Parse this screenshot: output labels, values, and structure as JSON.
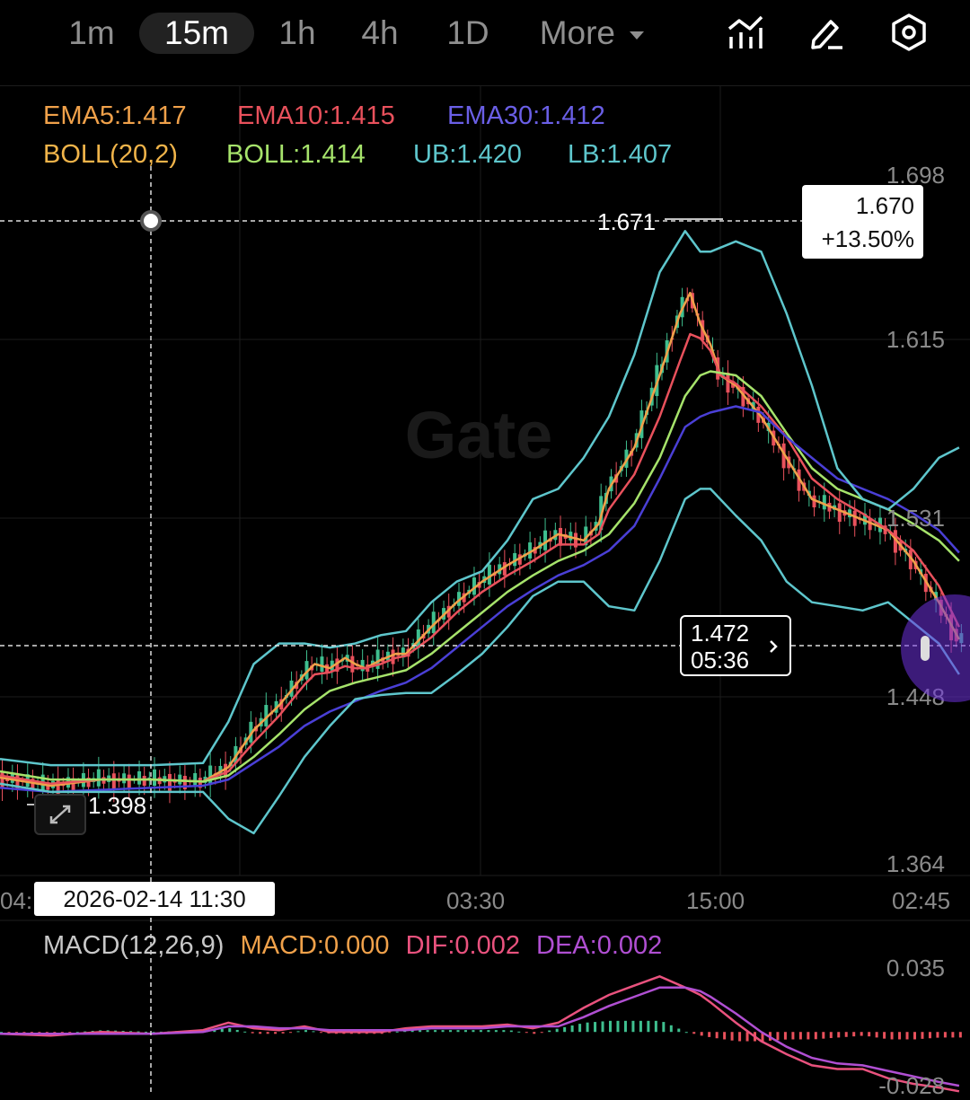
{
  "toolbar": {
    "timeframes": [
      "1m",
      "15m",
      "1h",
      "4h",
      "1D"
    ],
    "active_timeframe": "15m",
    "more_label": "More",
    "icons": [
      "indicator-icon",
      "draw-pen-icon",
      "settings-icon"
    ]
  },
  "legend": {
    "ema5": "EMA5:1.417",
    "ema10": "EMA10:1.415",
    "ema30": "EMA30:1.412",
    "boll_params": "BOLL(20,2)",
    "boll": "BOLL:1.414",
    "ub": "UB:1.420",
    "lb": "LB:1.407"
  },
  "price_box": {
    "price": "1.670",
    "change": "+13.50%"
  },
  "high_label": "1.671",
  "low_label": "1.398",
  "current": {
    "price": "1.472",
    "countdown": "05:36"
  },
  "crosshair_time": "2026-02-14 11:30",
  "watermark": "Gate",
  "macd_legend": {
    "params": "MACD(12,26,9)",
    "macd": "MACD:0.000",
    "dif": "DIF:0.002",
    "dea": "DEA:0.002"
  },
  "colors": {
    "up": "#3fbf8f",
    "down": "#e9515c",
    "ema5": "#f0a14a",
    "ema10": "#e9515c",
    "ema30": "#4a3fd6",
    "boll": "#a6e36b",
    "bands": "#5ec6cc",
    "dif": "#e9527e",
    "dea": "#b04fd2"
  },
  "chart_data": [
    {
      "type": "candlestick",
      "x_tick_labels": [
        "04:",
        "03:30",
        "15:00",
        "02:45"
      ],
      "y_tick_labels": [
        "1.698",
        "1.615",
        "1.531",
        "1.448",
        "1.364"
      ],
      "ylim": [
        1.364,
        1.698
      ],
      "grid": true,
      "series": [
        {
          "name": "EMA5",
          "x": [
            0,
            10,
            20,
            30,
            40,
            45,
            50,
            55,
            60,
            62,
            65,
            68,
            70,
            72,
            75,
            78,
            80,
            85,
            90,
            95,
            100,
            105,
            110,
            115,
            118,
            120,
            125,
            130,
            134,
            136,
            138,
            140,
            142,
            145,
            150,
            155,
            160,
            165,
            170,
            175,
            180,
            185,
            189
          ],
          "values": [
            1.405,
            1.401,
            1.404,
            1.404,
            1.403,
            1.41,
            1.428,
            1.44,
            1.455,
            1.46,
            1.458,
            1.463,
            1.46,
            1.458,
            1.462,
            1.465,
            1.465,
            1.478,
            1.49,
            1.5,
            1.508,
            1.515,
            1.523,
            1.52,
            1.528,
            1.545,
            1.565,
            1.6,
            1.63,
            1.64,
            1.625,
            1.615,
            1.6,
            1.595,
            1.58,
            1.56,
            1.54,
            1.535,
            1.53,
            1.525,
            1.51,
            1.49,
            1.472
          ]
        },
        {
          "name": "EMA10",
          "x": [
            0,
            10,
            20,
            30,
            40,
            45,
            50,
            55,
            60,
            62,
            65,
            68,
            70,
            72,
            75,
            78,
            80,
            85,
            90,
            95,
            100,
            105,
            110,
            115,
            118,
            120,
            125,
            130,
            134,
            136,
            138,
            140,
            142,
            145,
            150,
            155,
            160,
            165,
            170,
            175,
            180,
            185,
            189
          ],
          "values": [
            1.406,
            1.402,
            1.404,
            1.404,
            1.403,
            1.408,
            1.422,
            1.435,
            1.45,
            1.455,
            1.456,
            1.459,
            1.458,
            1.458,
            1.46,
            1.463,
            1.464,
            1.473,
            1.485,
            1.495,
            1.503,
            1.51,
            1.518,
            1.518,
            1.523,
            1.535,
            1.552,
            1.58,
            1.607,
            1.62,
            1.618,
            1.612,
            1.6,
            1.596,
            1.585,
            1.57,
            1.55,
            1.54,
            1.533,
            1.525,
            1.515,
            1.498,
            1.478
          ]
        },
        {
          "name": "BOLL",
          "x": [
            0,
            10,
            20,
            30,
            40,
            45,
            50,
            55,
            60,
            65,
            70,
            75,
            80,
            85,
            90,
            95,
            100,
            105,
            110,
            115,
            120,
            125,
            130,
            135,
            138,
            140,
            145,
            150,
            155,
            160,
            165,
            170,
            175,
            180,
            185,
            189
          ],
          "values": [
            1.408,
            1.404,
            1.404,
            1.404,
            1.403,
            1.406,
            1.415,
            1.426,
            1.438,
            1.447,
            1.451,
            1.454,
            1.457,
            1.465,
            1.475,
            1.485,
            1.495,
            1.503,
            1.51,
            1.515,
            1.523,
            1.538,
            1.56,
            1.59,
            1.6,
            1.602,
            1.6,
            1.59,
            1.572,
            1.555,
            1.545,
            1.54,
            1.535,
            1.528,
            1.52,
            1.51
          ]
        },
        {
          "name": "EMA30",
          "x": [
            0,
            10,
            20,
            30,
            40,
            45,
            50,
            55,
            60,
            65,
            70,
            75,
            80,
            85,
            90,
            95,
            100,
            105,
            110,
            115,
            120,
            125,
            130,
            135,
            138,
            140,
            145,
            150,
            155,
            160,
            165,
            170,
            175,
            180,
            185,
            189
          ],
          "values": [
            1.4,
            1.398,
            1.399,
            1.4,
            1.401,
            1.404,
            1.412,
            1.42,
            1.43,
            1.437,
            1.442,
            1.447,
            1.451,
            1.458,
            1.468,
            1.478,
            1.488,
            1.496,
            1.503,
            1.508,
            1.515,
            1.527,
            1.55,
            1.575,
            1.58,
            1.582,
            1.585,
            1.582,
            1.57,
            1.56,
            1.55,
            1.545,
            1.54,
            1.533,
            1.525,
            1.514
          ]
        },
        {
          "name": "UB",
          "x": [
            0,
            10,
            20,
            30,
            40,
            45,
            50,
            55,
            60,
            65,
            70,
            75,
            80,
            85,
            90,
            95,
            100,
            105,
            110,
            115,
            120,
            125,
            130,
            135,
            138,
            140,
            145,
            150,
            155,
            160,
            165,
            170,
            175,
            180,
            185,
            189
          ],
          "values": [
            1.414,
            1.411,
            1.411,
            1.411,
            1.412,
            1.432,
            1.46,
            1.47,
            1.47,
            1.468,
            1.47,
            1.474,
            1.476,
            1.49,
            1.5,
            1.505,
            1.52,
            1.54,
            1.545,
            1.56,
            1.58,
            1.61,
            1.65,
            1.67,
            1.66,
            1.66,
            1.665,
            1.66,
            1.63,
            1.595,
            1.555,
            1.54,
            1.535,
            1.545,
            1.56,
            1.565
          ]
        },
        {
          "name": "LB",
          "x": [
            0,
            10,
            20,
            30,
            40,
            45,
            50,
            55,
            60,
            65,
            70,
            75,
            80,
            85,
            90,
            95,
            100,
            105,
            110,
            115,
            120,
            125,
            130,
            135,
            138,
            140,
            145,
            150,
            155,
            160,
            165,
            170,
            175,
            180,
            185,
            189
          ],
          "values": [
            1.402,
            1.398,
            1.398,
            1.398,
            1.398,
            1.385,
            1.378,
            1.396,
            1.415,
            1.43,
            1.443,
            1.445,
            1.446,
            1.446,
            1.455,
            1.465,
            1.478,
            1.493,
            1.5,
            1.5,
            1.488,
            1.486,
            1.51,
            1.54,
            1.545,
            1.545,
            1.532,
            1.52,
            1.5,
            1.49,
            1.488,
            1.486,
            1.49,
            1.48,
            1.47,
            1.455
          ]
        }
      ]
    },
    {
      "type": "line",
      "y_tick_labels": [
        "0.035",
        "-0.028"
      ],
      "ylim": [
        -0.028,
        0.035
      ],
      "series": [
        {
          "name": "DIF",
          "x": [
            0,
            10,
            20,
            30,
            40,
            45,
            50,
            55,
            60,
            65,
            70,
            75,
            80,
            85,
            90,
            95,
            100,
            105,
            110,
            115,
            120,
            125,
            130,
            135,
            138,
            140,
            145,
            150,
            155,
            160,
            165,
            170,
            175,
            180,
            185,
            189
          ],
          "values": [
            -0.001,
            -0.002,
            0.0,
            -0.001,
            0.001,
            0.005,
            0.002,
            0.001,
            0.003,
            0.0,
            0.0,
            0.0,
            0.002,
            0.003,
            0.003,
            0.003,
            0.004,
            0.002,
            0.005,
            0.013,
            0.02,
            0.025,
            0.03,
            0.024,
            0.02,
            0.016,
            0.005,
            -0.005,
            -0.012,
            -0.018,
            -0.02,
            -0.02,
            -0.025,
            -0.028,
            -0.03,
            -0.032
          ]
        },
        {
          "name": "DEA",
          "x": [
            0,
            10,
            20,
            30,
            40,
            45,
            50,
            55,
            60,
            65,
            70,
            75,
            80,
            85,
            90,
            95,
            100,
            105,
            110,
            115,
            120,
            125,
            130,
            135,
            138,
            140,
            145,
            150,
            155,
            160,
            165,
            170,
            175,
            180,
            185,
            189
          ],
          "values": [
            -0.001,
            -0.001,
            -0.001,
            -0.001,
            0.0,
            0.003,
            0.003,
            0.002,
            0.002,
            0.001,
            0.001,
            0.001,
            0.001,
            0.002,
            0.002,
            0.002,
            0.003,
            0.003,
            0.003,
            0.008,
            0.014,
            0.019,
            0.024,
            0.024,
            0.022,
            0.019,
            0.01,
            0.0,
            -0.008,
            -0.014,
            -0.017,
            -0.018,
            -0.021,
            -0.024,
            -0.027,
            -0.029
          ]
        }
      ]
    }
  ]
}
